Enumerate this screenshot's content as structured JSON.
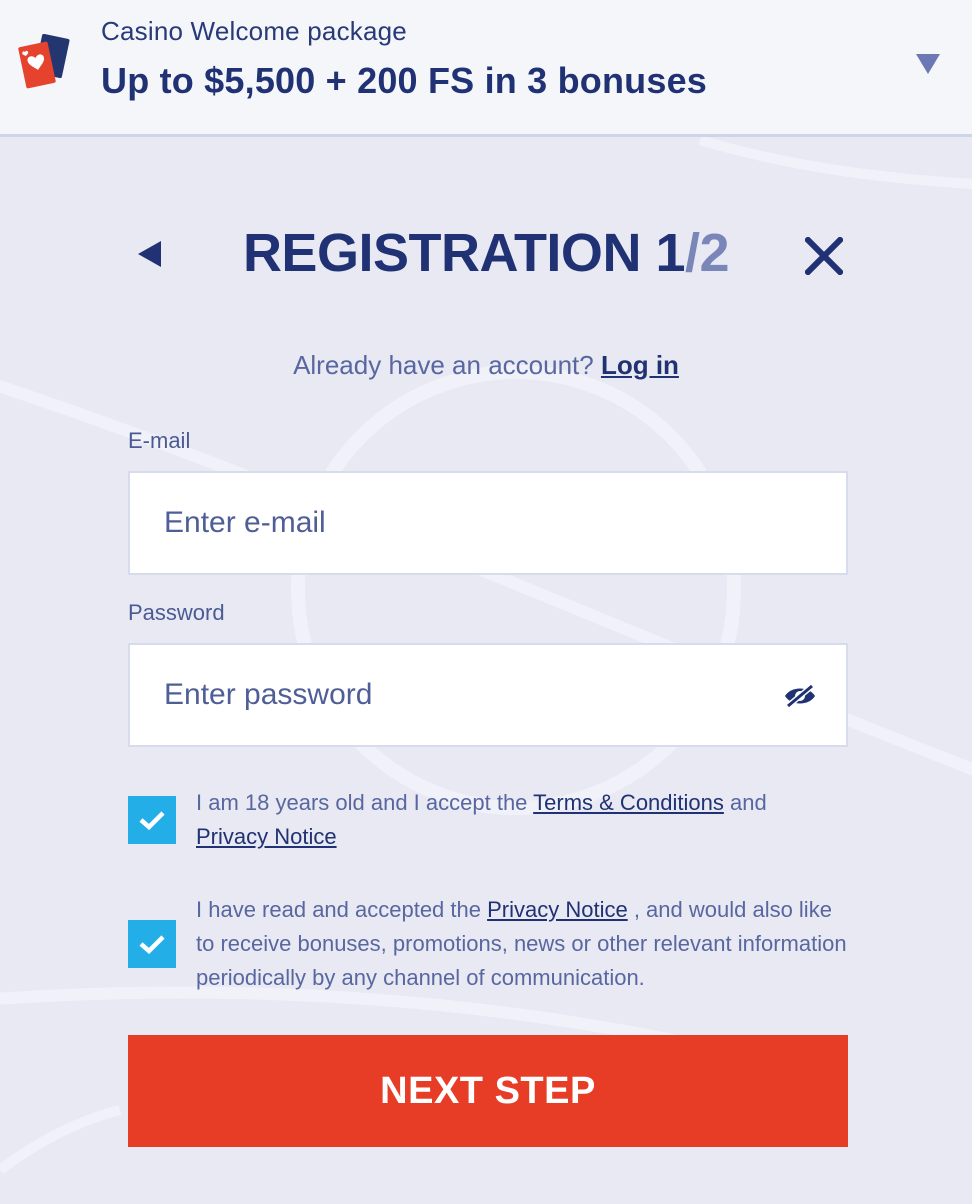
{
  "promo": {
    "subtitle": "Casino Welcome package",
    "title": "Up to $5,500 + 200 FS in 3 bonuses"
  },
  "registration": {
    "title_prefix": "REGISTRATION",
    "step_current": "1",
    "step_total": "/2"
  },
  "login_prompt": {
    "text": "Already have an account?",
    "link": "Log in"
  },
  "email": {
    "label": "E-mail",
    "placeholder": "Enter e-mail",
    "value": ""
  },
  "password": {
    "label": "Password",
    "placeholder": "Enter password",
    "value": ""
  },
  "consent_terms": {
    "checked": true,
    "text_before": "I am 18 years old and I accept the ",
    "terms_link": "Terms & Conditions",
    "text_middle": " and ",
    "privacy_link": "Privacy Notice"
  },
  "consent_marketing": {
    "checked": true,
    "text_before": "I have read and accepted the ",
    "privacy_link": "Privacy Notice",
    "text_after": " , and would also like to receive bonuses, promotions, news or other relevant information periodically by any channel of communication."
  },
  "next_button": {
    "label": "NEXT STEP"
  },
  "icons": {
    "promo": "playing-cards-icon",
    "promo_toggle": "triangle-down-icon",
    "back": "triangle-left-icon",
    "close": "close-icon",
    "password_visibility": "eye-hidden-icon",
    "checkbox": "checkmark-icon"
  },
  "colors": {
    "background": "#e8e9f3",
    "primary_text": "#203273",
    "muted_text": "#5867a0",
    "checkbox": "#24aee8",
    "cta": "#e73d27",
    "card_red": "#e5432d",
    "card_navy": "#24366f"
  }
}
